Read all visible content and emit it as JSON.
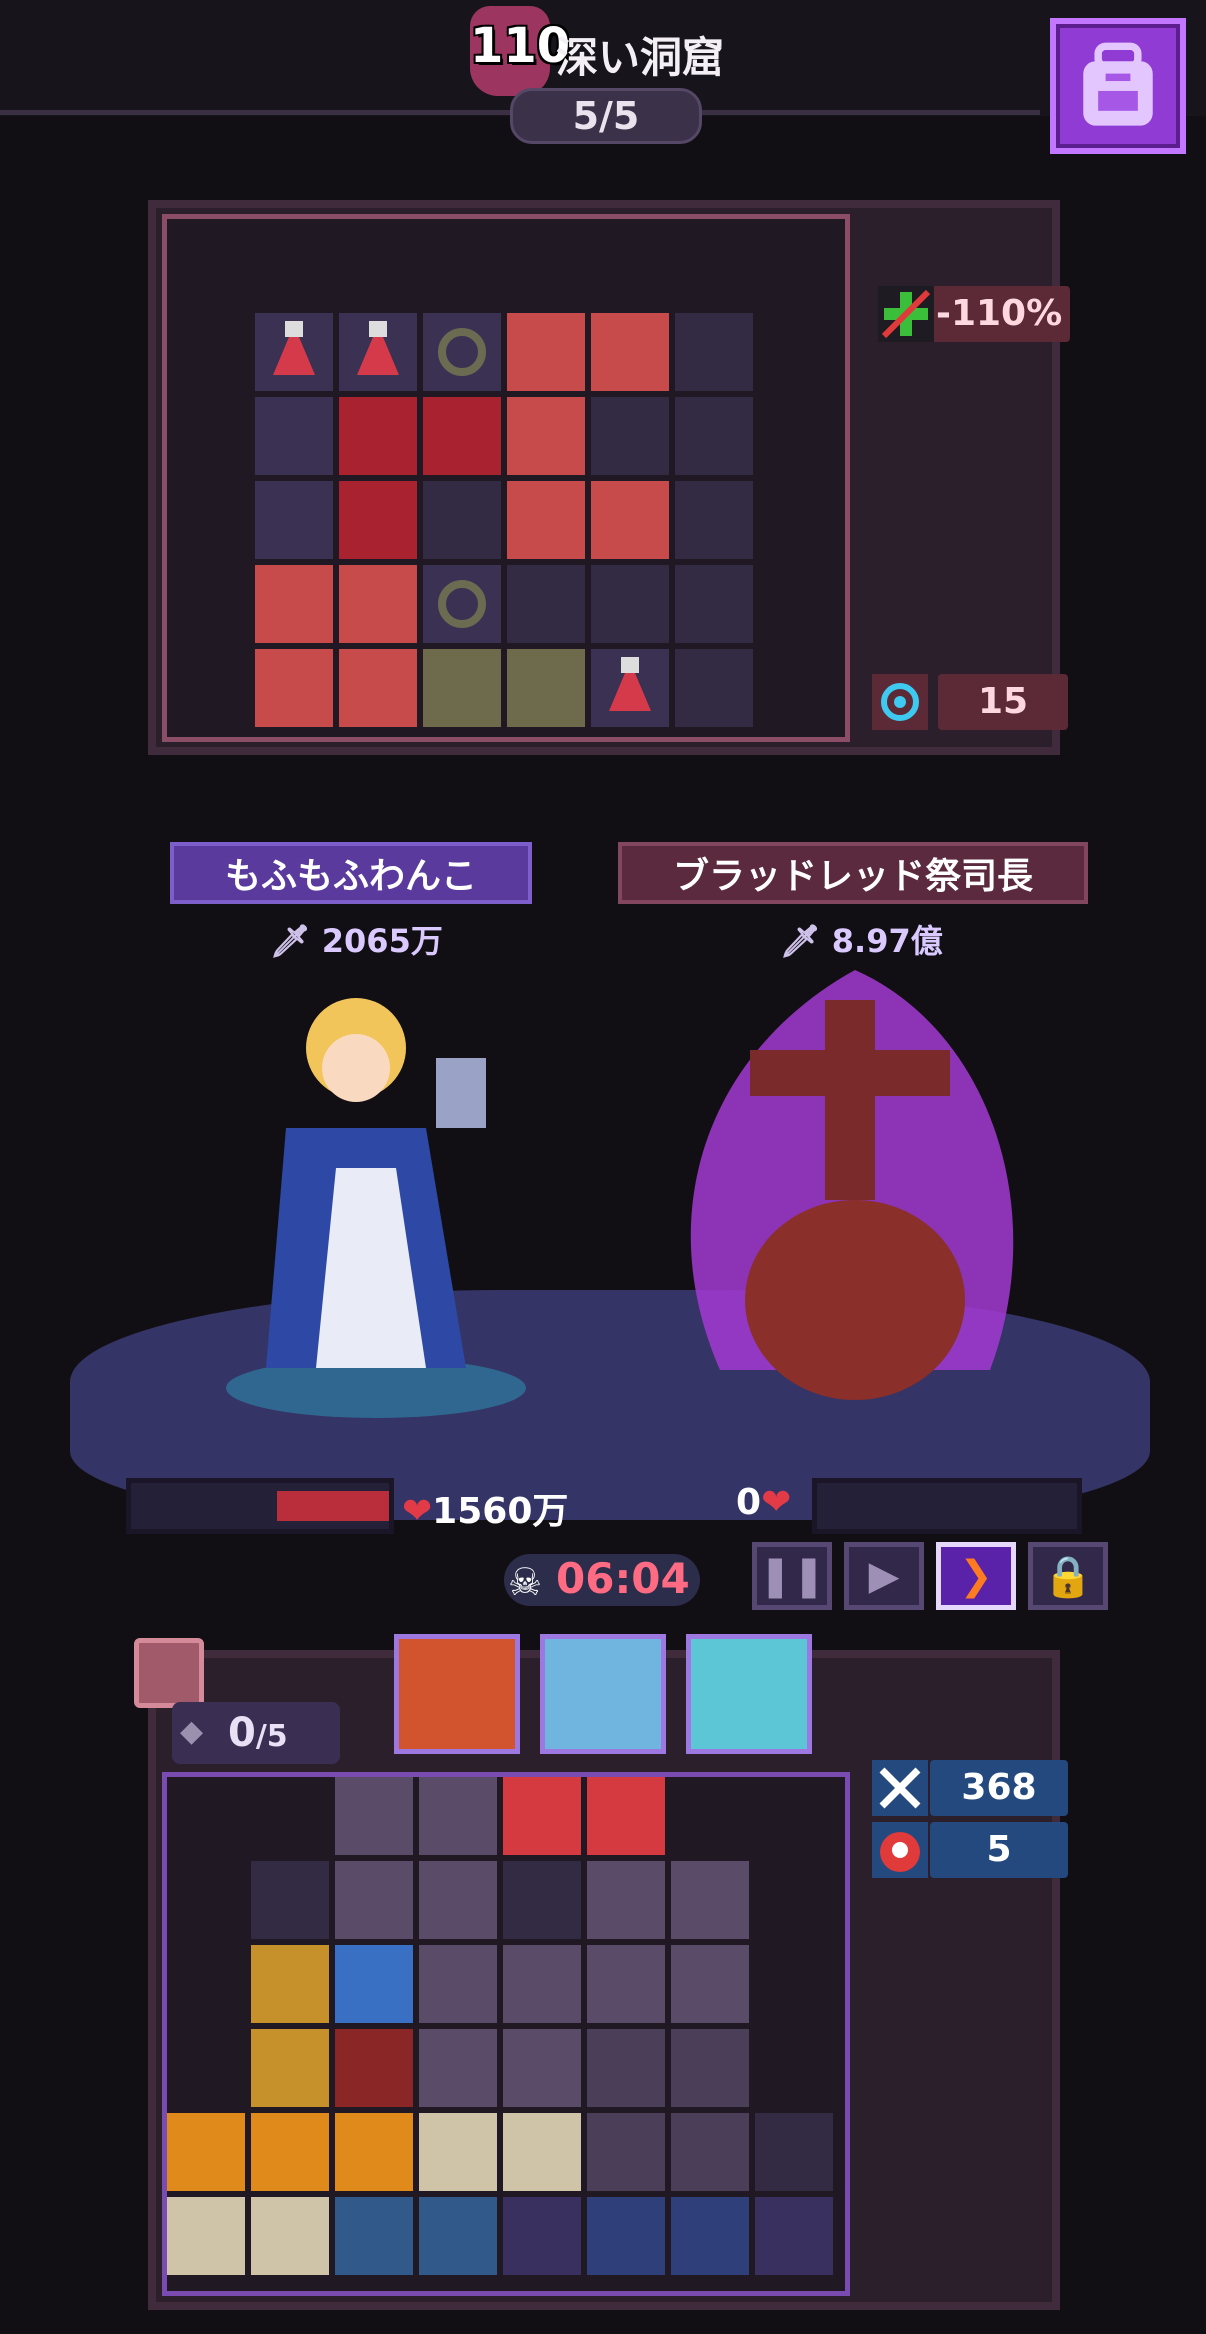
{
  "header": {
    "stage_level": "110",
    "stage_name": "深い洞窟",
    "progress": "5/5"
  },
  "enemy_panel": {
    "stat_modifier": "-110%",
    "stat_count": "15"
  },
  "battle": {
    "player": {
      "name": "もふもふわんこ",
      "power": "2065万",
      "hp": "1560万",
      "hp_fraction": 0.45
    },
    "enemy": {
      "name": "ブラッドレッド祭司長",
      "power": "8.97億",
      "hp": "0",
      "hp_fraction": 0
    },
    "timer": "06:04"
  },
  "controls": [
    "pause",
    "play",
    "fast-forward",
    "lock"
  ],
  "player_panel": {
    "slot_count": "0",
    "slot_max": "/5",
    "stat_attack": "368",
    "stat_defense": "5"
  },
  "colors": {
    "accent": "#8f3bd4",
    "enemy": "#5b2a3f",
    "hp": "#b92e3a",
    "timer": "#ff6b82"
  }
}
